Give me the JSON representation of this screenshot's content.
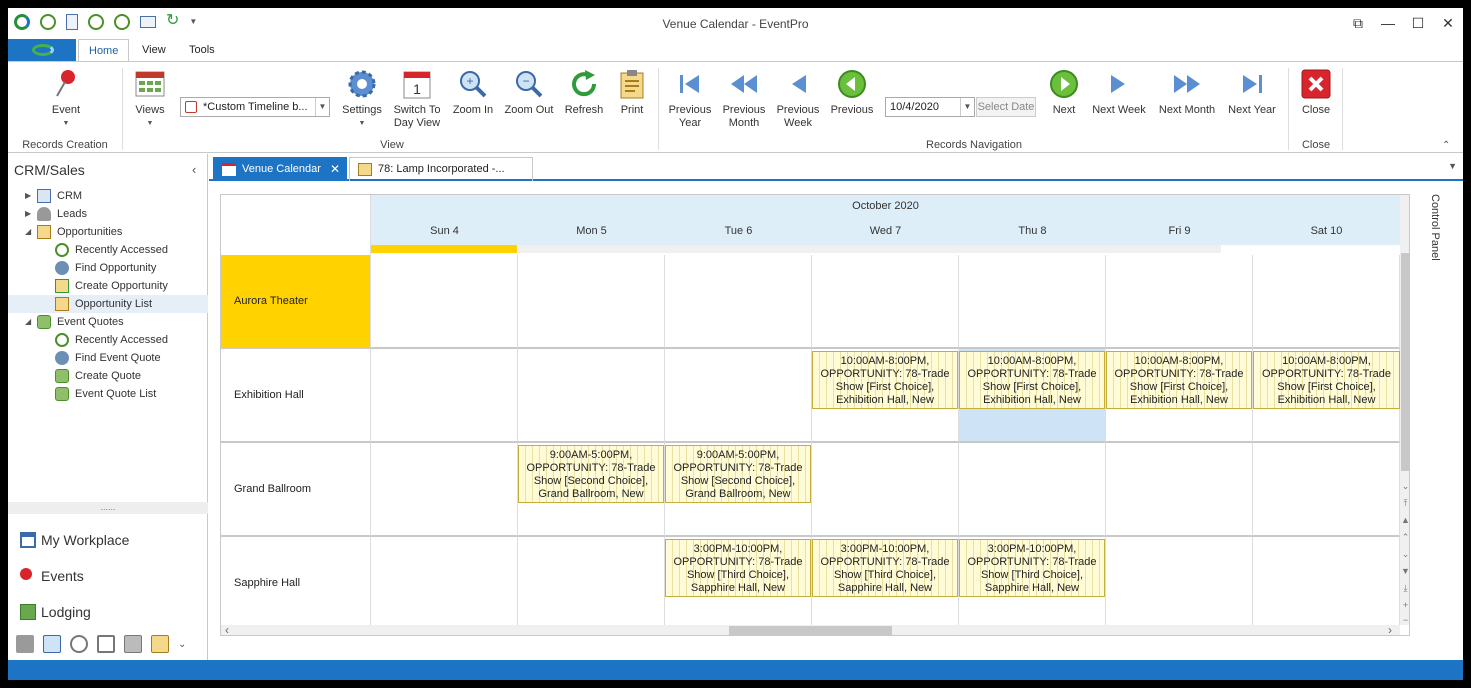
{
  "window": {
    "title": "Venue Calendar - EventPro",
    "controls": [
      "restore-down-icon",
      "minimize-icon",
      "maximize-icon",
      "close-icon"
    ]
  },
  "ribbon": {
    "tabs": [
      "Home",
      "View",
      "Tools"
    ],
    "active_tab": "Home",
    "event_label": "Event",
    "views_label": "Views",
    "view_combo_value": "*Custom Timeline b...",
    "settings_label": "Settings",
    "switch_day_label_1": "Switch To",
    "switch_day_label_2": "Day View",
    "zoom_in_label": "Zoom In",
    "zoom_out_label": "Zoom Out",
    "refresh_label": "Refresh",
    "print_label": "Print",
    "prev_year_1": "Previous",
    "prev_year_2": "Year",
    "prev_month_1": "Previous",
    "prev_month_2": "Month",
    "prev_week_1": "Previous",
    "prev_week_2": "Week",
    "previous_label": "Previous",
    "date_value": "10/4/2020",
    "select_date_label": "Select Date",
    "next_label": "Next",
    "next_week_label": "Next Week",
    "next_month_label": "Next Month",
    "next_year_label": "Next Year",
    "close_label": "Close",
    "groups": {
      "records_creation": "Records Creation",
      "view": "View",
      "records_navigation": "Records Navigation",
      "close": "Close"
    }
  },
  "nav": {
    "header": "CRM/Sales",
    "tree": {
      "crm": "CRM",
      "leads": "Leads",
      "opportunities": "Opportunities",
      "opp_recent": "Recently Accessed",
      "opp_find": "Find Opportunity",
      "opp_create": "Create Opportunity",
      "opp_list": "Opportunity List",
      "event_quotes": "Event Quotes",
      "eq_recent": "Recently Accessed",
      "eq_find": "Find Event Quote",
      "eq_create": "Create Quote",
      "eq_list": "Event Quote List"
    },
    "splitter": "......",
    "sections": {
      "workplace": "My Workplace",
      "events": "Events",
      "lodging": "Lodging"
    }
  },
  "doc_tabs": {
    "venue_calendar": "Venue Calendar",
    "lamp": "78: Lamp Incorporated -..."
  },
  "calendar": {
    "month": "October 2020",
    "days": [
      "Sun 4",
      "Mon 5",
      "Tue 6",
      "Wed 7",
      "Thu 8",
      "Fri 9",
      "Sat 10"
    ],
    "venues": [
      "Aurora Theater",
      "Exhibition Hall",
      "Grand Ballroom",
      "Sapphire Hall"
    ],
    "appt_exhibition": "10:00AM-8:00PM, OPPORTUNITY: 78-Trade Show [First Choice], Exhibition Hall, New",
    "appt_ballroom": "9:00AM-5:00PM, OPPORTUNITY: 78-Trade Show [Second Choice], Grand Ballroom, New",
    "appt_sapphire": "3:00PM-10:00PM, OPPORTUNITY: 78-Trade Show [Third Choice], Sapphire Hall, New"
  },
  "control_panel": "Control Panel",
  "colors": {
    "accent": "#1e74c4",
    "today": "#ffd200",
    "header_bg": "#ddeef9",
    "appointment": "#fffbd6"
  }
}
